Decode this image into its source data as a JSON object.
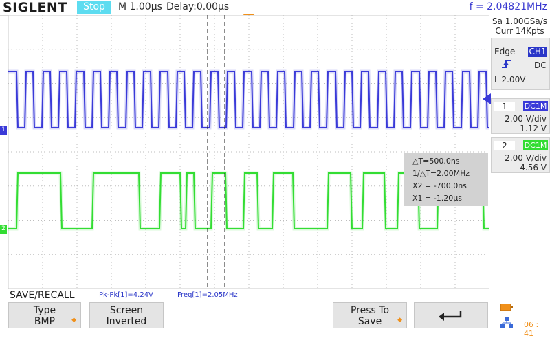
{
  "header": {
    "brand": "SIGLENT",
    "run_status": "Stop",
    "timebase": "M 1.00μs",
    "delay": "Delay:0.00μs",
    "frequency": "f = 2.04821MHz"
  },
  "acquisition": {
    "sample_rate": "Sa 1.00GSa/s",
    "memory_depth": "Curr 14Kpts"
  },
  "trigger": {
    "mode": "Edge",
    "source": "CH1",
    "slope_icon": "rising-edge-icon",
    "coupling": "DC",
    "level": "L  2.00V"
  },
  "channels": [
    {
      "number": "1",
      "coupling": "DC1M",
      "scale": "2.00 V/div",
      "offset": "1.12 V",
      "color": "#3a3ad8"
    },
    {
      "number": "2",
      "coupling": "DC1M",
      "scale": "2.00 V/div",
      "offset": "-4.56 V",
      "color": "#33dd33"
    }
  ],
  "cursors": {
    "delta_t": "△T=500.0ns",
    "inverse_delta_t": "1/△T=2.00MHz",
    "x2": "X2 = -700.0ns",
    "x1": "X1 = -1.20μs"
  },
  "measurements": {
    "pk_pk": "Pk-Pk[1]=4.24V",
    "freq": "Freq[1]=2.05MHz"
  },
  "menu": {
    "title": "SAVE/RECALL",
    "softkeys": [
      {
        "line1": "Type",
        "line2": "BMP",
        "has_arrow": true
      },
      {
        "line1": "Screen",
        "line2": "Inverted",
        "has_arrow": false
      },
      {
        "line1": "Press To",
        "line2": "Save",
        "has_arrow": true
      },
      {
        "icon": "return-arrow-icon"
      }
    ]
  },
  "status": {
    "time": "06 : 41",
    "icons": [
      "battery-icon",
      "network-icon"
    ]
  },
  "waveforms": {
    "ch1": {
      "high_level": 3.3,
      "low_level": 0,
      "unit": "V",
      "frequency_mhz": 2.05
    },
    "ch2": {
      "high_level": 3.3,
      "low_level": 0,
      "unit": "V"
    }
  },
  "colors": {
    "ch1": "#3a3ad8",
    "ch2": "#33dd33",
    "trigger_marker": "#f0901a",
    "stop_badge": "#5ddcf0"
  }
}
